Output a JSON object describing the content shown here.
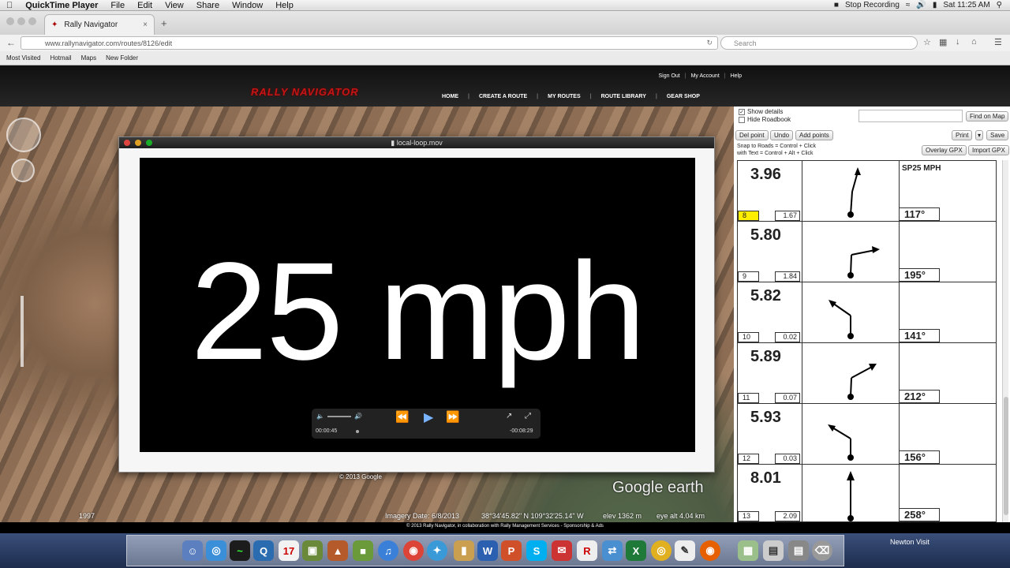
{
  "menubar": {
    "app": "QuickTime Player",
    "items": [
      "File",
      "Edit",
      "View",
      "Share",
      "Window",
      "Help"
    ],
    "status": "Stop Recording",
    "clock": "Sat 11:25 AM"
  },
  "browser": {
    "tab_title": "Rally Navigator",
    "url": "www.rallynavigator.com/routes/8126/edit",
    "search_placeholder": "Search",
    "bookmarks": [
      "Most Visited",
      "Hotmail",
      "Maps",
      "New Folder"
    ]
  },
  "site": {
    "top_links": [
      "Sign Out",
      "My Account",
      "Help"
    ],
    "logo": "RALLY NAVIGATOR",
    "nav": [
      "HOME",
      "CREATE A ROUTE",
      "MY ROUTES",
      "ROUTE LIBRARY",
      "GEAR SHOP"
    ]
  },
  "quicktime": {
    "filename": "local-loop.mov",
    "video_text": "25 mph",
    "elapsed": "00:00:45",
    "remaining": "-00:08:29"
  },
  "panel": {
    "show_details": "Show details",
    "hide_roadbook": "Hide Roadbook",
    "find_on_map": "Find on Map",
    "buttons": [
      "Del point",
      "Undo",
      "Add points"
    ],
    "print": "Print",
    "save": "Save",
    "hint1": "Snap to Roads = Control + Click",
    "hint2": "with Text = Control + Alt + Click",
    "overlay": "Overlay GPX",
    "import": "Import GPX"
  },
  "roadbook": [
    {
      "dist": "3.96",
      "num": "8",
      "partial": "1.67",
      "note": "SP25 MPH",
      "heading": "117°",
      "highlight": true
    },
    {
      "dist": "5.80",
      "num": "9",
      "partial": "1.84",
      "note": "",
      "heading": "195°",
      "highlight": false
    },
    {
      "dist": "5.82",
      "num": "10",
      "partial": "0.02",
      "note": "",
      "heading": "141°",
      "highlight": false
    },
    {
      "dist": "5.89",
      "num": "11",
      "partial": "0.07",
      "note": "",
      "heading": "212°",
      "highlight": false
    },
    {
      "dist": "5.93",
      "num": "12",
      "partial": "0.03",
      "note": "",
      "heading": "156°",
      "highlight": false
    },
    {
      "dist": "8.01",
      "num": "13",
      "partial": "2.09",
      "note": "",
      "heading": "258°",
      "highlight": false
    }
  ],
  "map": {
    "imagery_date": "Imagery Date: 6/8/2013",
    "coords": "38°34'45.82\" N  109°32'25.14\" W",
    "elev": "elev  1362 m",
    "eye_alt": "eye alt   4.04 km",
    "year": "1997",
    "google_copy": "© 2013 Google",
    "brand": "Google earth"
  },
  "footer": {
    "copyright": "© 2013 Rally Navigator, in collaboration with Rally Management Services - Sponsorship & Ads"
  },
  "dock": {
    "right_label": "Newton Visit"
  }
}
